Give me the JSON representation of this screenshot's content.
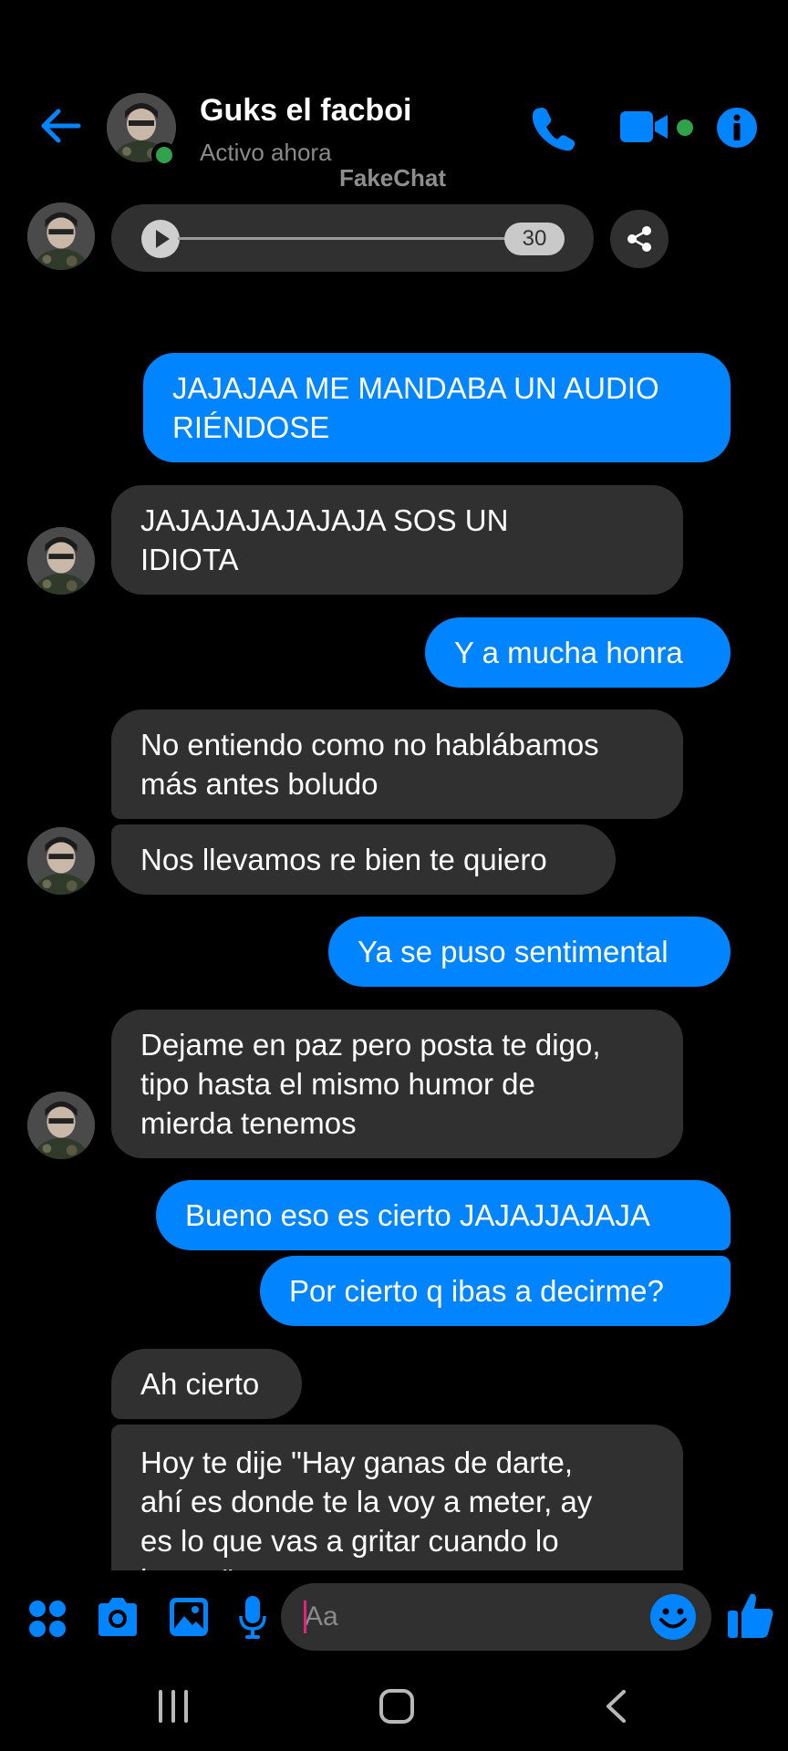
{
  "header": {
    "contact_name": "Guks el facboi",
    "status": "Activo ahora",
    "watermark": "FakeChat",
    "accent_color": "#0084ff",
    "online_color": "#31a24c",
    "icons": [
      "back-arrow-icon",
      "phone-call-icon",
      "video-call-icon",
      "info-icon"
    ]
  },
  "audio_message": {
    "duration": "30",
    "icons": [
      "play-icon",
      "share-icon"
    ]
  },
  "messages": [
    {
      "direction": "out",
      "lines": [
        "JAJAJAA ME MANDABA UN AUDIO",
        "RIÉNDOSE"
      ]
    },
    {
      "direction": "in",
      "lines": [
        "JAJAJAJAJAJAJA SOS UN",
        "IDIOTA"
      ]
    },
    {
      "direction": "out",
      "lines": [
        "Y a mucha honra"
      ]
    },
    {
      "direction": "in",
      "lines": [
        "No entiendo como no hablábamos",
        "más antes boludo"
      ]
    },
    {
      "direction": "in",
      "lines": [
        "Nos llevamos re bien te quiero"
      ]
    },
    {
      "direction": "out",
      "lines": [
        "Ya se puso sentimental"
      ]
    },
    {
      "direction": "in",
      "lines": [
        "Dejame en paz pero posta te digo,",
        "tipo hasta el mismo humor de",
        "mierda tenemos"
      ]
    },
    {
      "direction": "out",
      "lines": [
        "Bueno eso es cierto JAJAJJAJAJA"
      ]
    },
    {
      "direction": "out",
      "lines": [
        "Por cierto q ibas a decirme?"
      ]
    },
    {
      "direction": "in",
      "lines": [
        "Ah cierto"
      ]
    },
    {
      "direction": "in",
      "lines": [
        "Hoy te dije \"Hay ganas de darte,",
        "ahí es donde te la voy a meter, ay",
        "es lo que vas a gritar cuando lo",
        "hagas\""
      ]
    }
  ],
  "composer": {
    "placeholder": "Aa",
    "value": "",
    "icons": [
      "apps-menu-icon",
      "camera-icon",
      "gallery-icon",
      "microphone-icon",
      "emoji-icon",
      "thumbs-up-icon"
    ]
  },
  "system_nav": {
    "icons": [
      "recent-apps-icon",
      "home-icon",
      "back-icon"
    ]
  }
}
